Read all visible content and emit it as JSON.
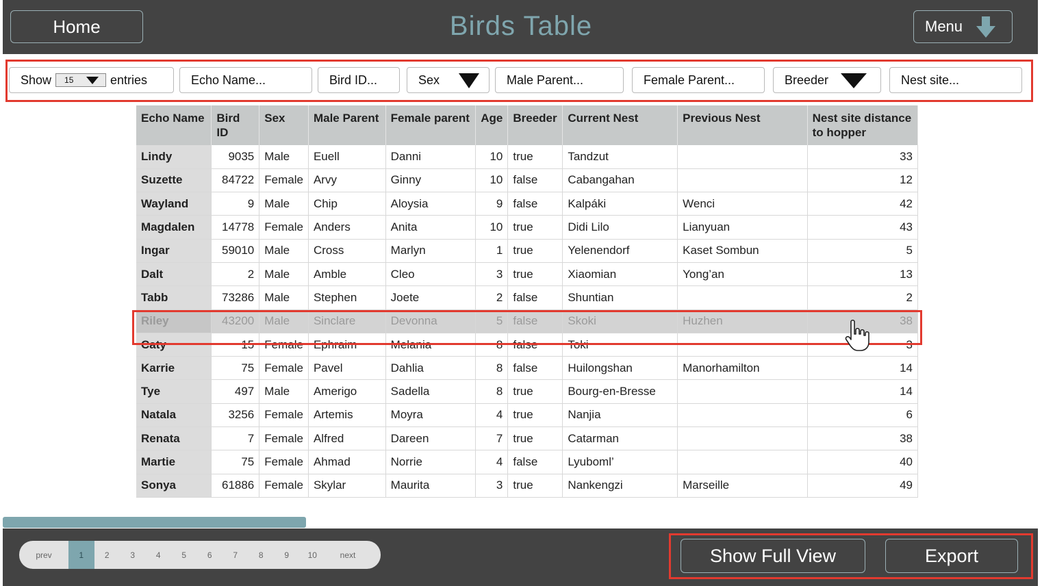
{
  "header": {
    "home_label": "Home",
    "title": "Birds Table",
    "menu_label": "Menu",
    "menu_icon": "arrow-down-icon"
  },
  "filters": {
    "show_label": "Show",
    "entries_value": "15",
    "entries_label": "entries",
    "echo_name_placeholder": "Echo Name...",
    "bird_id_placeholder": "Bird ID...",
    "sex_label": "Sex",
    "male_parent_placeholder": "Male Parent...",
    "female_parent_placeholder": "Female Parent...",
    "breeder_label": "Breeder",
    "nest_site_placeholder": "Nest site..."
  },
  "table": {
    "columns": [
      "Echo Name",
      "Bird ID",
      "Sex",
      "Male Parent",
      "Female parent",
      "Age",
      "Breeder",
      "Current Nest",
      "Previous Nest",
      "Nest site distance to hopper"
    ],
    "rows": [
      [
        "Lindy",
        "9035",
        "Male",
        "Euell",
        "Danni",
        "10",
        "true",
        "Tandzut",
        "",
        "33"
      ],
      [
        "Suzette",
        "84722",
        "Female",
        "Arvy",
        "Ginny",
        "10",
        "false",
        "Cabangahan",
        "",
        "12"
      ],
      [
        "Wayland",
        "9",
        "Male",
        "Chip",
        "Aloysia",
        "9",
        "false",
        "Kalpáki",
        "Wenci",
        "42"
      ],
      [
        "Magdalen",
        "14778",
        "Female",
        "Anders",
        "Anita",
        "10",
        "true",
        "Didi Lilo",
        "Lianyuan",
        "43"
      ],
      [
        "Ingar",
        "59010",
        "Male",
        "Cross",
        "Marlyn",
        "1",
        "true",
        "Yelenendorf",
        "Kaset Sombun",
        "5"
      ],
      [
        "Dalt",
        "2",
        "Male",
        "Amble",
        "Cleo",
        "3",
        "true",
        "Xiaomian",
        "Yong’an",
        "13"
      ],
      [
        "Tabb",
        "73286",
        "Male",
        "Stephen",
        "Joete",
        "2",
        "false",
        "Shuntian",
        "",
        "2"
      ],
      [
        "Riley",
        "43200",
        "Male",
        "Sinclare",
        "Devonna",
        "5",
        "false",
        "Skoki",
        "Huzhen",
        "38"
      ],
      [
        "Caty",
        "15",
        "Female",
        "Ephraim",
        "Melania",
        "8",
        "false",
        "Toki",
        "",
        "3"
      ],
      [
        "Karrie",
        "75",
        "Female",
        "Pavel",
        "Dahlia",
        "8",
        "false",
        "Huilongshan",
        "Manorhamilton",
        "14"
      ],
      [
        "Tye",
        "497",
        "Male",
        "Amerigo",
        "Sadella",
        "8",
        "true",
        "Bourg-en-Bresse",
        "",
        "14"
      ],
      [
        "Natala",
        "3256",
        "Female",
        "Artemis",
        "Moyra",
        "4",
        "true",
        "Nanjia",
        "",
        "6"
      ],
      [
        "Renata",
        "7",
        "Female",
        "Alfred",
        "Dareen",
        "7",
        "true",
        "Catarman",
        "",
        "38"
      ],
      [
        "Martie",
        "75",
        "Female",
        "Ahmad",
        "Norrie",
        "4",
        "false",
        "Lyuboml’",
        "",
        "40"
      ],
      [
        "Sonya",
        "61886",
        "Female",
        "Skylar",
        "Maurita",
        "3",
        "true",
        "Nankengzi",
        "Marseille",
        "49"
      ]
    ],
    "highlighted_row": 7
  },
  "pagination": {
    "prev_label": "prev",
    "pages": [
      "1",
      "2",
      "3",
      "4",
      "5",
      "6",
      "7",
      "8",
      "9",
      "10"
    ],
    "active_page": "1",
    "next_label": "next"
  },
  "footer": {
    "full_view_label": "Show Full View",
    "export_label": "Export"
  },
  "colors": {
    "header_bg": "#434343",
    "title": "#7fa6ae",
    "accent": "#7ea6ae",
    "highlight_border": "#e23a2f"
  }
}
